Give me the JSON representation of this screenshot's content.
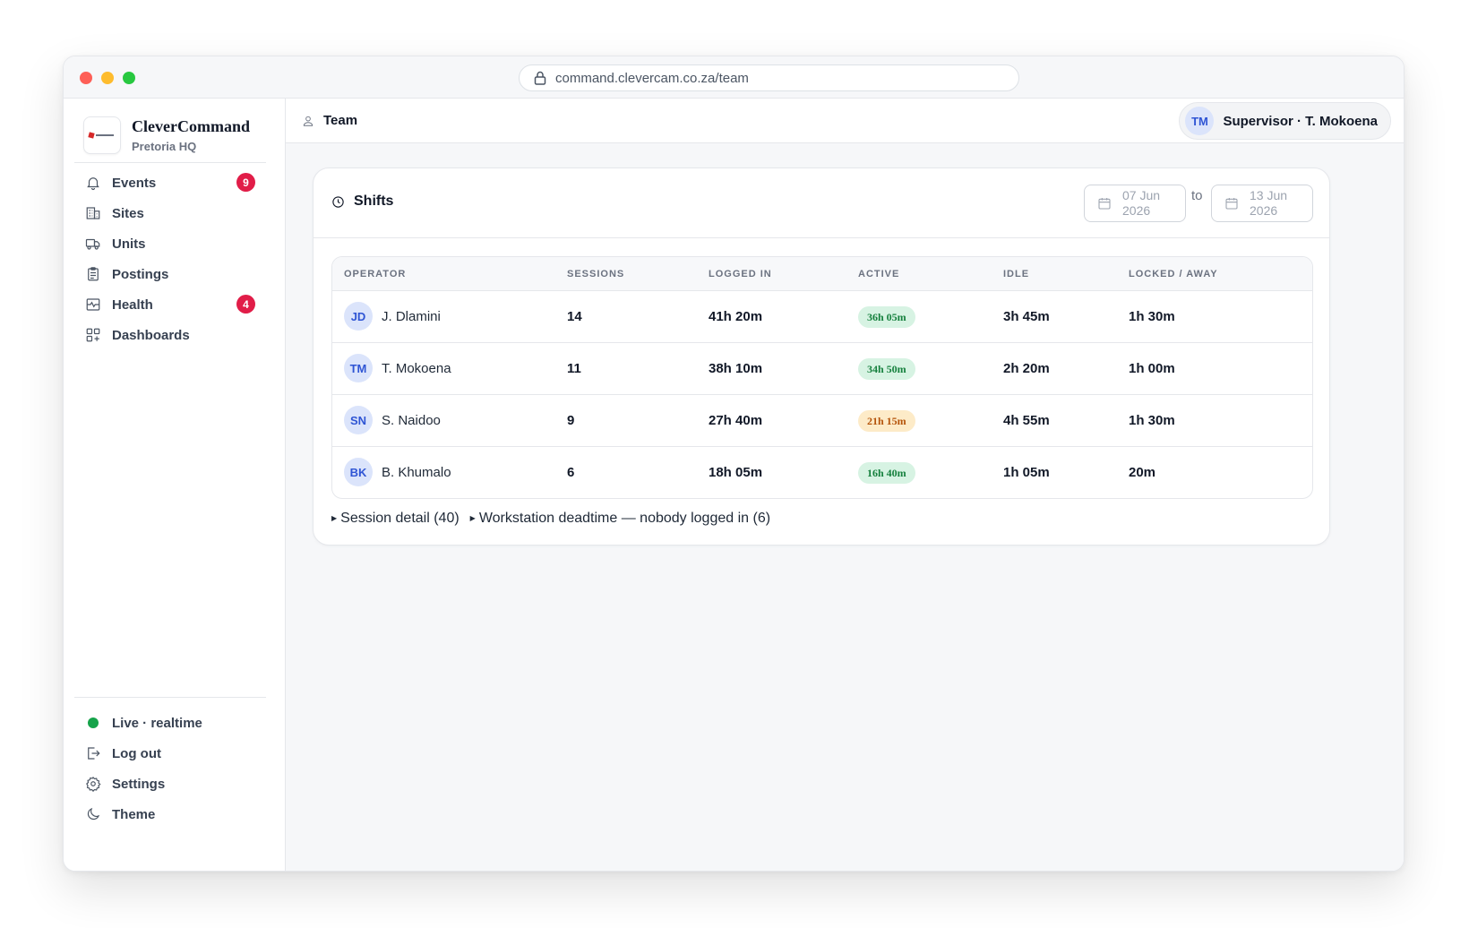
{
  "browser": {
    "url": "command.clevercam.co.za/team"
  },
  "brand": {
    "name": "CleverCommand",
    "subtitle": "Pretoria HQ"
  },
  "nav": [
    {
      "label": "Events",
      "icon": "bell-icon",
      "badge": "9"
    },
    {
      "label": "Sites",
      "icon": "building-icon"
    },
    {
      "label": "Units",
      "icon": "truck-icon"
    },
    {
      "label": "Postings",
      "icon": "clipboard-icon"
    },
    {
      "label": "Health",
      "icon": "pulse-icon",
      "badge": "4"
    },
    {
      "label": "Dashboards",
      "icon": "grid-plus-icon"
    }
  ],
  "bottom_nav": {
    "live": "Live · realtime",
    "logout": "Log out",
    "settings": "Settings",
    "theme": "Theme"
  },
  "header": {
    "title": "Team",
    "user_initials": "TM",
    "user_label": "Supervisor · T. Mokoena"
  },
  "shifts": {
    "title": "Shifts",
    "from_date": "07 Jun 2026",
    "to_label": "to",
    "to_date": "13 Jun 2026",
    "columns": [
      "OPERATOR",
      "SESSIONS",
      "LOGGED IN",
      "ACTIVE",
      "IDLE",
      "LOCKED / AWAY"
    ],
    "rows": [
      {
        "initials": "JD",
        "name": "J. Dlamini",
        "sessions": "14",
        "logged_in": "41h 20m",
        "active": "36h 05m",
        "active_status": "good",
        "idle": "3h 45m",
        "locked": "1h 30m"
      },
      {
        "initials": "TM",
        "name": "T. Mokoena",
        "sessions": "11",
        "logged_in": "38h 10m",
        "active": "34h 50m",
        "active_status": "good",
        "idle": "2h 20m",
        "locked": "1h 00m"
      },
      {
        "initials": "SN",
        "name": "S. Naidoo",
        "sessions": "9",
        "logged_in": "27h 40m",
        "active": "21h 15m",
        "active_status": "warn",
        "idle": "4h 55m",
        "locked": "1h 30m"
      },
      {
        "initials": "BK",
        "name": "B. Khumalo",
        "sessions": "6",
        "logged_in": "18h 05m",
        "active": "16h 40m",
        "active_status": "good",
        "idle": "1h 05m",
        "locked": "20m"
      }
    ],
    "details": {
      "session_detail": "Session detail (40)",
      "deadtime": "Workstation deadtime — nobody logged in (6)"
    }
  },
  "colors": {
    "badge": "#e11d48",
    "live": "#16a34a",
    "good_pill": "#d7f3e3",
    "warn_pill": "#fdebc8"
  }
}
